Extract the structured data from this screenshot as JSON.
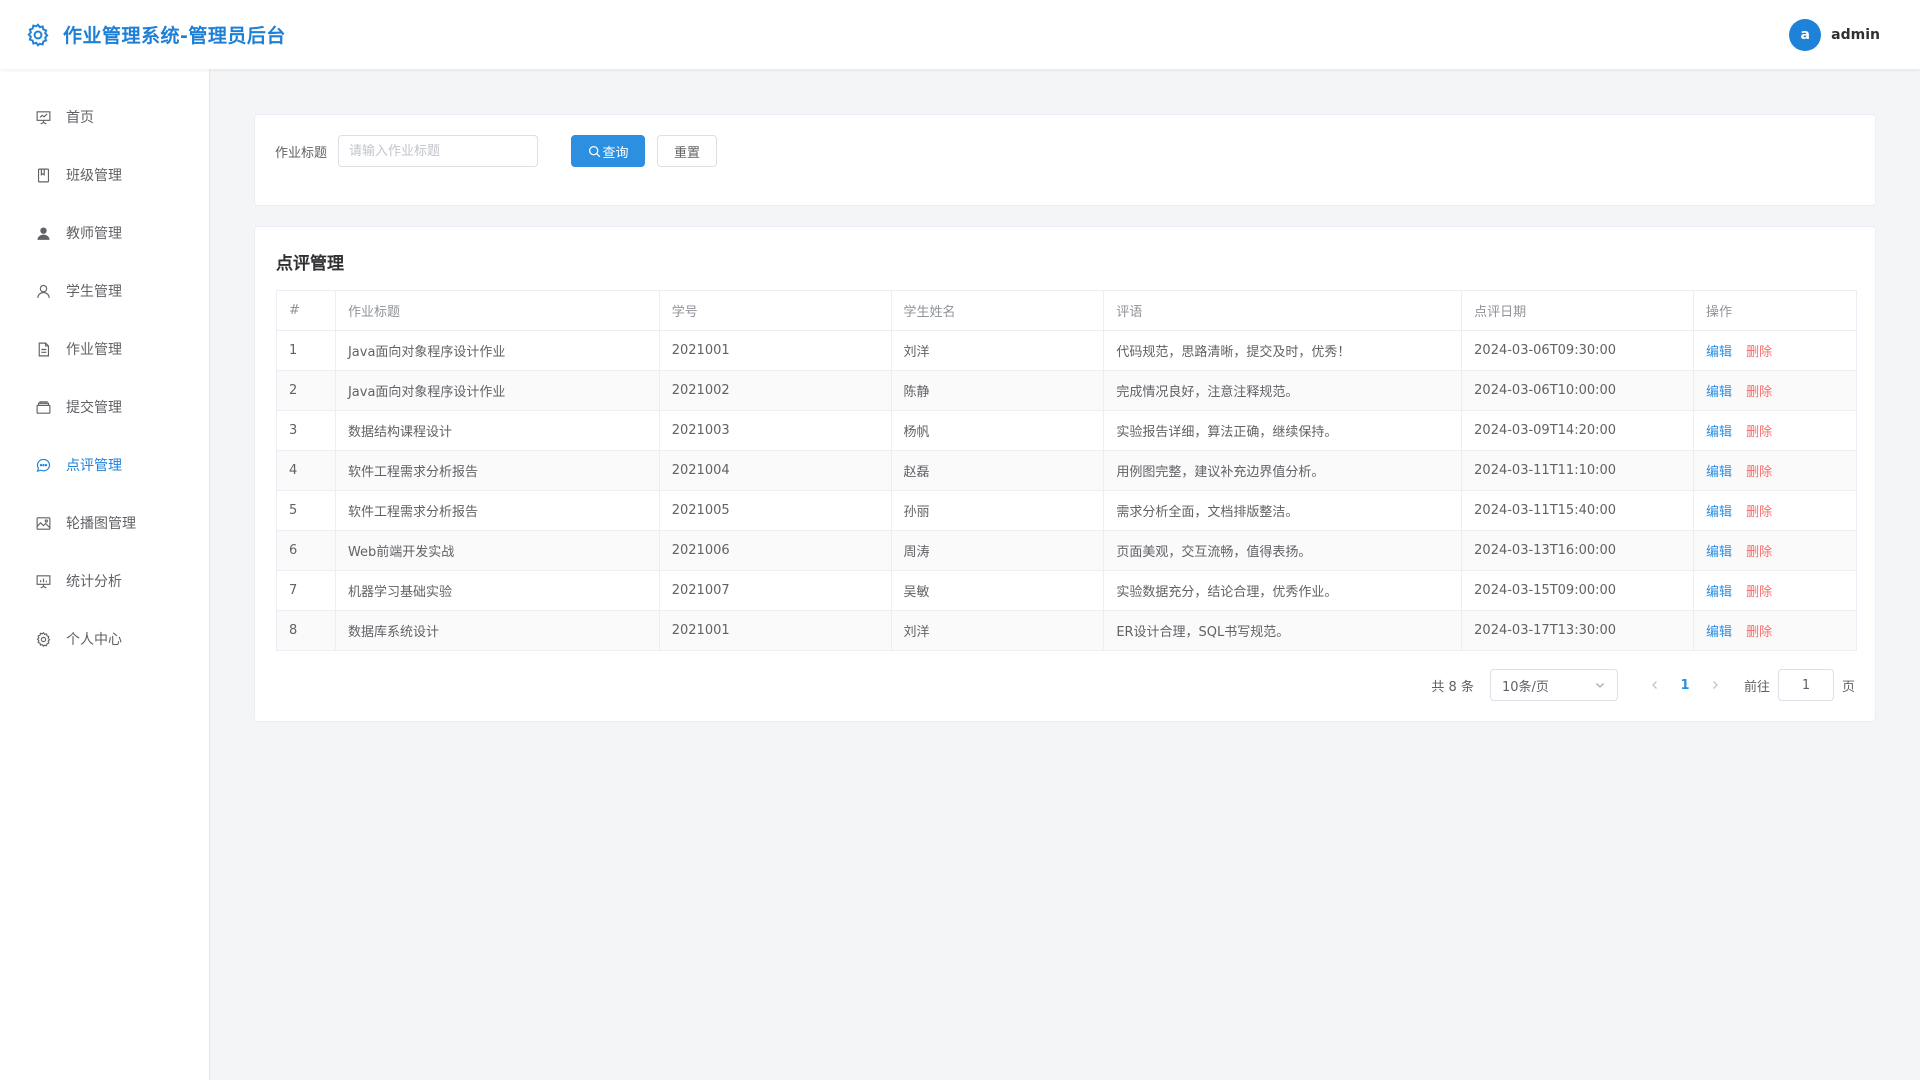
{
  "header": {
    "title": "作业管理系统-管理员后台",
    "brand_icon": "gear-icon",
    "avatar_letter": "a",
    "username": "admin",
    "accent_color": "#1e82d9"
  },
  "sidebar": {
    "items": [
      {
        "label": "首页",
        "icon": "presentation-icon",
        "active": false
      },
      {
        "label": "班级管理",
        "icon": "notebook-icon",
        "active": false
      },
      {
        "label": "教师管理",
        "icon": "user-filled-icon",
        "active": false
      },
      {
        "label": "学生管理",
        "icon": "user-icon",
        "active": false
      },
      {
        "label": "作业管理",
        "icon": "document-icon",
        "active": false
      },
      {
        "label": "提交管理",
        "icon": "box-icon",
        "active": false
      },
      {
        "label": "点评管理",
        "icon": "chat-icon",
        "active": true
      },
      {
        "label": "轮播图管理",
        "icon": "picture-icon",
        "active": false
      },
      {
        "label": "统计分析",
        "icon": "chart-board-icon",
        "active": false
      },
      {
        "label": "个人中心",
        "icon": "gear-icon",
        "active": false
      }
    ]
  },
  "search": {
    "label": "作业标题",
    "placeholder": "请输入作业标题",
    "value": "",
    "query_label": "查询",
    "reset_label": "重置"
  },
  "table": {
    "title": "点评管理",
    "columns": [
      "#",
      "作业标题",
      "学号",
      "学生姓名",
      "评语",
      "点评日期",
      "操作"
    ],
    "edit_label": "编辑",
    "delete_label": "删除",
    "rows": [
      [
        "1",
        "Java面向对象程序设计作业",
        "2021001",
        "刘洋",
        "代码规范，思路清晰，提交及时，优秀！",
        "2024-03-06T09:30:00"
      ],
      [
        "2",
        "Java面向对象程序设计作业",
        "2021002",
        "陈静",
        "完成情况良好，注意注释规范。",
        "2024-03-06T10:00:00"
      ],
      [
        "3",
        "数据结构课程设计",
        "2021003",
        "杨帆",
        "实验报告详细，算法正确，继续保持。",
        "2024-03-09T14:20:00"
      ],
      [
        "4",
        "软件工程需求分析报告",
        "2021004",
        "赵磊",
        "用例图完整，建议补充边界值分析。",
        "2024-03-11T11:10:00"
      ],
      [
        "5",
        "软件工程需求分析报告",
        "2021005",
        "孙丽",
        "需求分析全面，文档排版整洁。",
        "2024-03-11T15:40:00"
      ],
      [
        "6",
        "Web前端开发实战",
        "2021006",
        "周涛",
        "页面美观，交互流畅，值得表扬。",
        "2024-03-13T16:00:00"
      ],
      [
        "7",
        "机器学习基础实验",
        "2021007",
        "吴敏",
        "实验数据充分，结论合理，优秀作业。",
        "2024-03-15T09:00:00"
      ],
      [
        "8",
        "数据库系统设计",
        "2021001",
        "刘洋",
        "ER设计合理，SQL书写规范。",
        "2024-03-17T13:30:00"
      ]
    ]
  },
  "pagination": {
    "total_text": "共 8 条",
    "page_size": "10条/页",
    "current_page": "1",
    "goto_label": "前往",
    "goto_value": "1",
    "goto_suffix": "页"
  }
}
